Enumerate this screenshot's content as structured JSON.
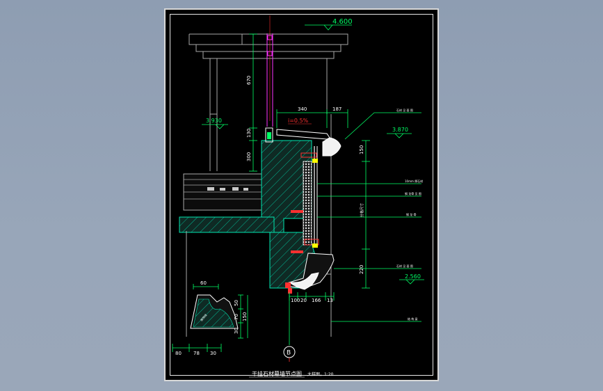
{
  "drawing": {
    "levels": {
      "top": "4.600",
      "left": "3.930",
      "right_upper": "3.870",
      "right_lower": "2.560"
    },
    "dimensions": {
      "d670": "670",
      "d130": "130",
      "d300": "300",
      "d340": "340",
      "d187": "187",
      "d150": "150",
      "d220": "220",
      "d100": "100",
      "d20": "20",
      "d166": "166",
      "d13": "13",
      "d60": "60",
      "d50": "50",
      "d70": "70",
      "d30v": "30",
      "d150b": "150",
      "d80": "80",
      "d78": "78",
      "d30": "30",
      "mid": "分格尺寸"
    },
    "slope": "i=0.5%",
    "notes": [
      "石材 见 面 图",
      "10mm 厚石材",
      "钢 龙骨 见 图",
      "钢 龙 骨",
      "石材 见 面 图",
      "结 构 梁"
    ],
    "profile_label": "装饰线",
    "axis": "B",
    "title": "干挂石材幕墙节点图",
    "scale": "大样图，1:20"
  },
  "colors": {
    "background": "#9aa7b9",
    "sheet": "#000000",
    "dimension": "#00ff66",
    "wall": "#a0a0a0",
    "hatch": "#00cc99",
    "accent_magenta": "#ff33ff",
    "accent_red": "#ff3030",
    "accent_yellow": "#ffff00"
  }
}
